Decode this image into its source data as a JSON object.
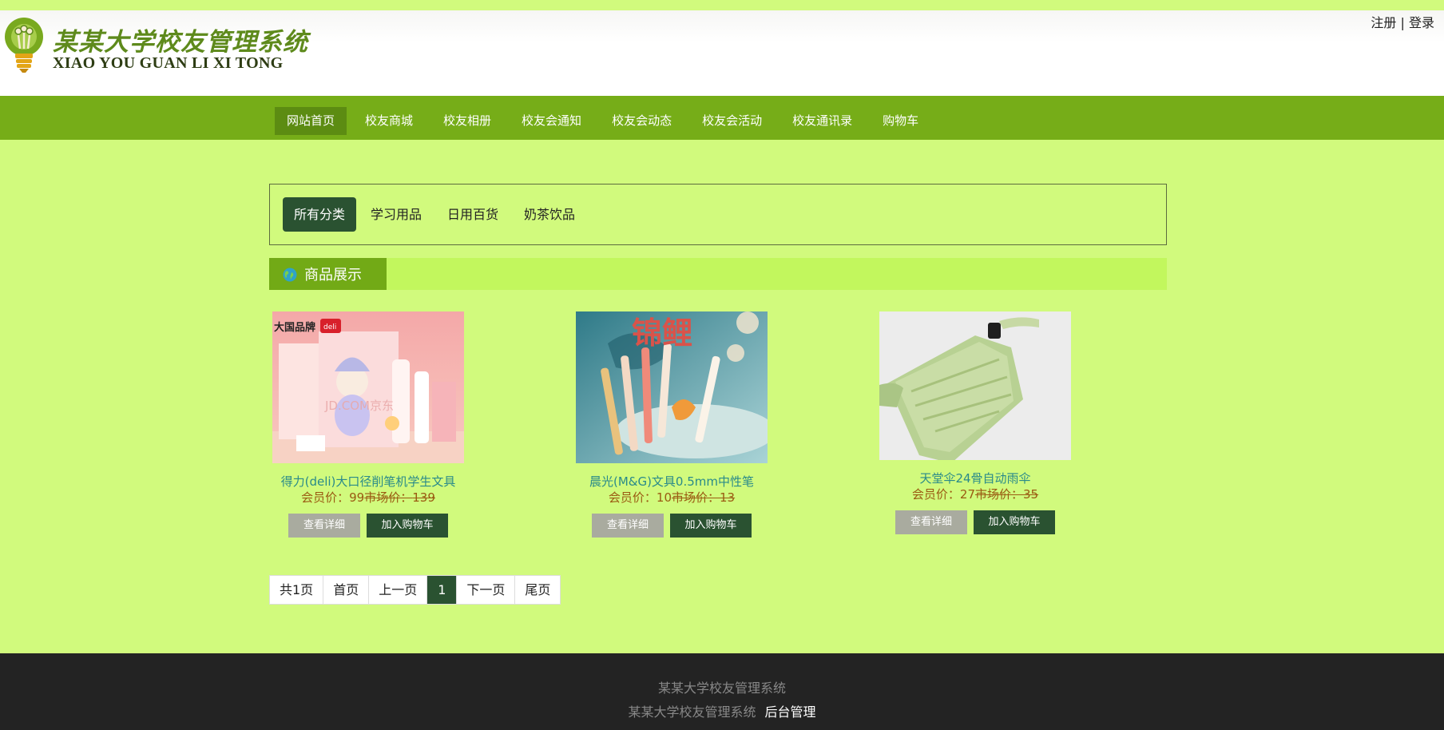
{
  "site": {
    "logo_cn": "某某大学校友管理系统",
    "logo_en": "XIAO YOU GUAN LI XI TONG",
    "register": "注册",
    "separator": "|",
    "login": "登录"
  },
  "nav": {
    "items": [
      "网站首页",
      "校友商城",
      "校友相册",
      "校友会通知",
      "校友会动态",
      "校友会活动",
      "校友通讯录",
      "购物车"
    ]
  },
  "categories": [
    "所有分类",
    "学习用品",
    "日用百货",
    "奶茶饮品"
  ],
  "section": {
    "title": "商品展示"
  },
  "products": [
    {
      "name": "得力(deli)大口径削笔机学生文具",
      "price_label": "会员价：",
      "price": "99",
      "market_label": "市场价：",
      "market_price": "139",
      "detail_btn": "查看详细",
      "cart_btn": "加入购物车"
    },
    {
      "name": "晨光(M&G)文具0.5mm中性笔",
      "price_label": "会员价：",
      "price": "10",
      "market_label": "市场价：",
      "market_price": "13",
      "detail_btn": "查看详细",
      "cart_btn": "加入购物车"
    },
    {
      "name": "天堂伞24骨自动雨伞",
      "price_label": "会员价：",
      "price": "27",
      "market_label": "市场价：",
      "market_price": "35",
      "detail_btn": "查看详细",
      "cart_btn": "加入购物车"
    }
  ],
  "image_text": {
    "brand_left": "大国品牌",
    "brand_right": "deli",
    "watermark": "JD.COM京东",
    "poster_title": "锦鲤"
  },
  "pagination": {
    "total": "共1页",
    "first": "首页",
    "prev": "上一页",
    "current": "1",
    "next": "下一页",
    "last": "尾页"
  },
  "footer": {
    "line1": "某某大学校友管理系统",
    "line2": "某某大学校友管理系统",
    "admin": "后台管理"
  },
  "colors": {
    "page_bg": "#d1fa7d",
    "nav_bg": "#76ad18",
    "nav_active": "#5c8c12",
    "dark_green": "#2a5231",
    "footer_bg": "#232323"
  }
}
